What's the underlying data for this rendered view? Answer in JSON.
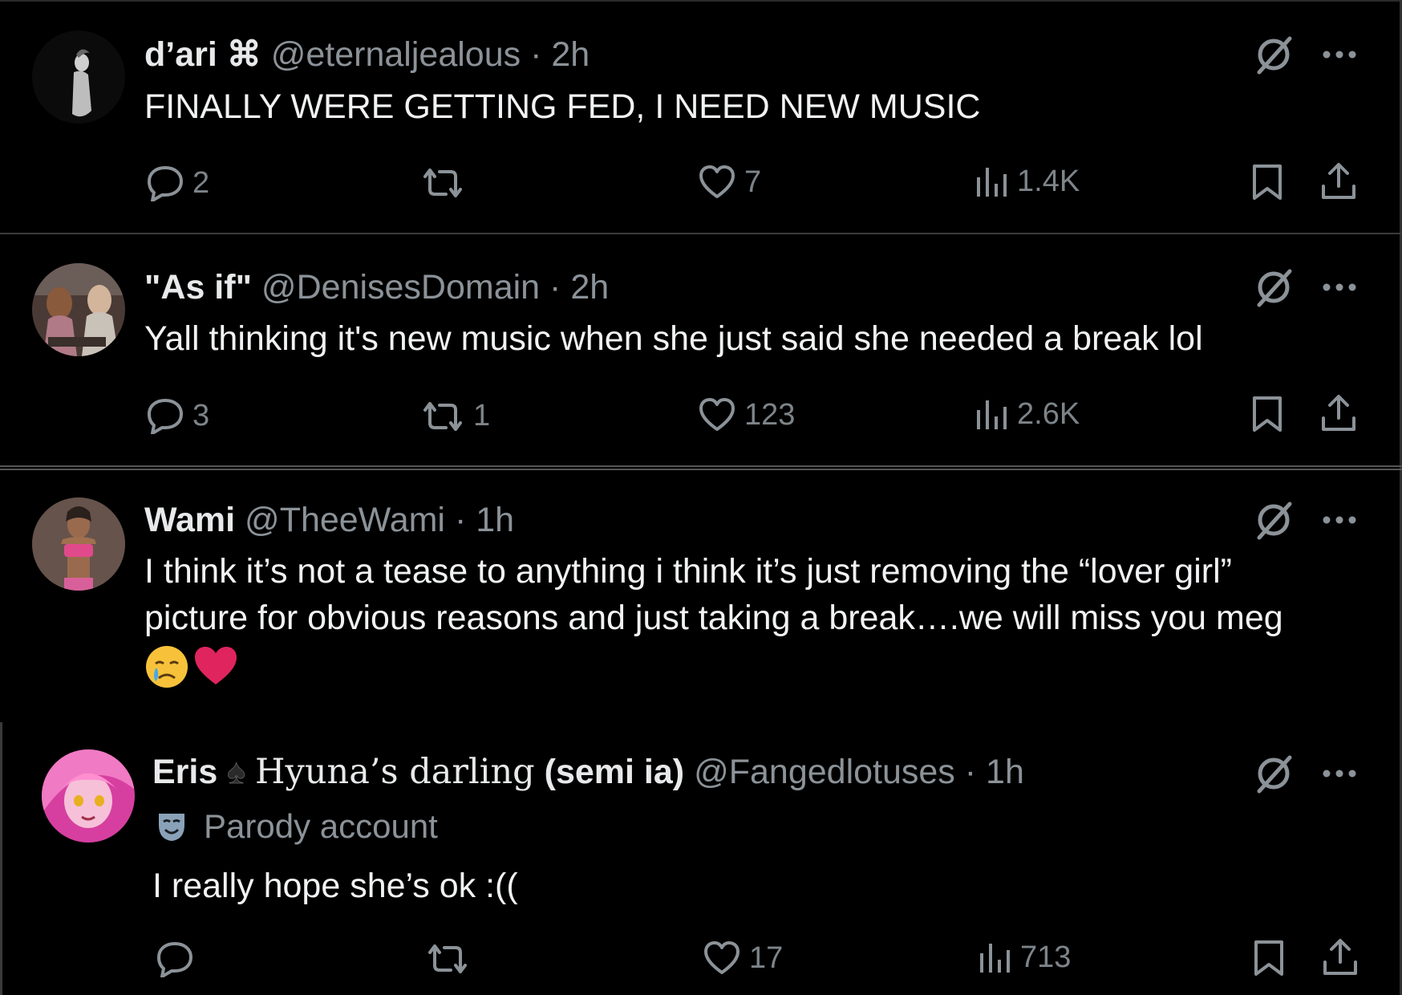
{
  "tweets": [
    {
      "name": "d’ari",
      "name_emoji": "⌘",
      "handle": "@eternaljealous",
      "time": "· 2h",
      "text": "FINALLY WERE GETTING FED, I NEED NEW MUSIC",
      "replies": "2",
      "reposts": "",
      "likes": "7",
      "views": "1.4K"
    },
    {
      "name": "\"As if\"",
      "handle": "@DenisesDomain",
      "time": "· 2h",
      "text": "Yall thinking it's new music when she just said she needed a break lol",
      "replies": "3",
      "reposts": "1",
      "likes": "123",
      "views": "2.6K"
    },
    {
      "name": "Wami",
      "handle": "@TheeWami",
      "time": "· 1h",
      "text_line1": "I think it’s not a tease to anything i think it’s just removing the “lover girl”",
      "text_line2": "picture for obvious reasons and just taking a break….we will miss you meg",
      "emojis": "😢❤️"
    },
    {
      "name": "Eris",
      "name_emoji": "♠",
      "name_mono": "Hyuna’s darling",
      "name_suffix": "(semi ia)",
      "handle": "@Fangedlotuses",
      "time": "· 1h",
      "badge": "Parody account",
      "text": "I really hope she’s ok :((",
      "replies": "",
      "reposts": "",
      "likes": "17",
      "views": "713"
    }
  ],
  "icons": {
    "reply": "reply-icon",
    "repost": "repost-icon",
    "like": "heart-icon",
    "views": "views-icon",
    "bookmark": "bookmark-icon",
    "share": "share-icon",
    "grok": "grok-icon",
    "more": "more-icon",
    "parody": "mask-icon"
  },
  "colors": {
    "background": "#000000",
    "text": "#e7e9ea",
    "secondary": "#8b9298",
    "heart_emoji": "#e0245e"
  }
}
